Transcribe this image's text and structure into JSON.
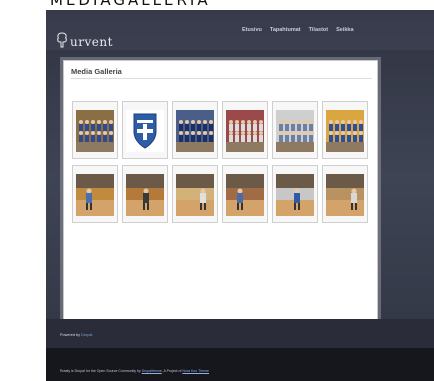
{
  "caption": "MEDIAGALLERIA",
  "site": {
    "logo_text": "urvent"
  },
  "nav": {
    "items": [
      "Etusivu",
      "Tapahtumat",
      "Tilastot",
      "Seikka"
    ]
  },
  "gallery": {
    "title": "Media Galleria",
    "row1": [
      {
        "type": "team",
        "bg": "#8a6f45",
        "accent": "#2f4b8f"
      },
      {
        "type": "logo",
        "bg": "#ffffff",
        "accent": "#2e5da8"
      },
      {
        "type": "team",
        "bg": "#4b5e8a",
        "accent": "#1e2f66"
      },
      {
        "type": "team",
        "bg": "#9a4a4a",
        "accent": "#dcdcdc"
      },
      {
        "type": "team",
        "bg": "#cfcfcf",
        "accent": "#6d7fa3"
      },
      {
        "type": "team",
        "bg": "#d9a640",
        "accent": "#2c4e9e"
      }
    ],
    "row2": [
      {
        "type": "court",
        "bg": "#c08a3f",
        "accent": "#4a6fb0"
      },
      {
        "type": "court",
        "bg": "#b37a3a",
        "accent": "#3a3a3a"
      },
      {
        "type": "court",
        "bg": "#d3b27a",
        "accent": "#e0e0e0"
      },
      {
        "type": "court",
        "bg": "#a06b45",
        "accent": "#4b6aa6"
      },
      {
        "type": "court",
        "bg": "#c7c7c7",
        "accent": "#2f5aa8"
      },
      {
        "type": "court",
        "bg": "#b89260",
        "accent": "#d8d8d8"
      }
    ]
  },
  "footer": {
    "powered_prefix": "Powered by",
    "powered_link": "Drupal",
    "bottom_prefix": "Rotaty is Drupal for the Open Source Community by",
    "bottom_link1": "Drupaltheme",
    "bottom_mid": ", A Project of",
    "bottom_link2": "Nora Koo Theme"
  }
}
